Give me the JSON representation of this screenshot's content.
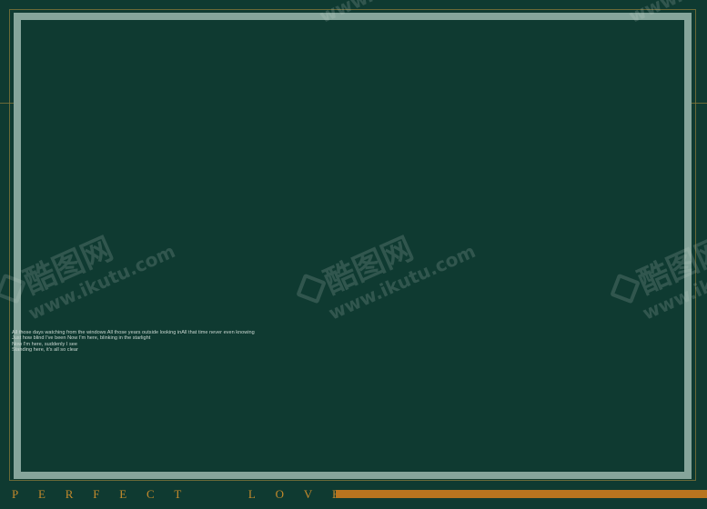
{
  "colors": {
    "background": "#0f3a31",
    "frame": "#86a59b",
    "guide_line": "#8a7a3a",
    "title_text": "#c48a2c",
    "accent_bar": "#b8741f",
    "lyrics_text": "#c9d7d1"
  },
  "lyrics": {
    "line1": "All those days watching from the windows All those years outside looking inAll that time never even knowing",
    "line2": "Just how blind I've been Now I'm here, blinking in the starlight",
    "line3": "Now I'm here, suddenly I see",
    "line4": "Standing here, it's all so clear"
  },
  "footer": {
    "title_word1": [
      "P",
      "E",
      "R",
      "F",
      "E",
      "C",
      "T"
    ],
    "title_word2": [
      "L",
      "O",
      "V",
      "E"
    ]
  },
  "watermark": {
    "brand": "酷图网",
    "url": "www.ikutu.com",
    "icon": "ikutu-logo-icon"
  }
}
